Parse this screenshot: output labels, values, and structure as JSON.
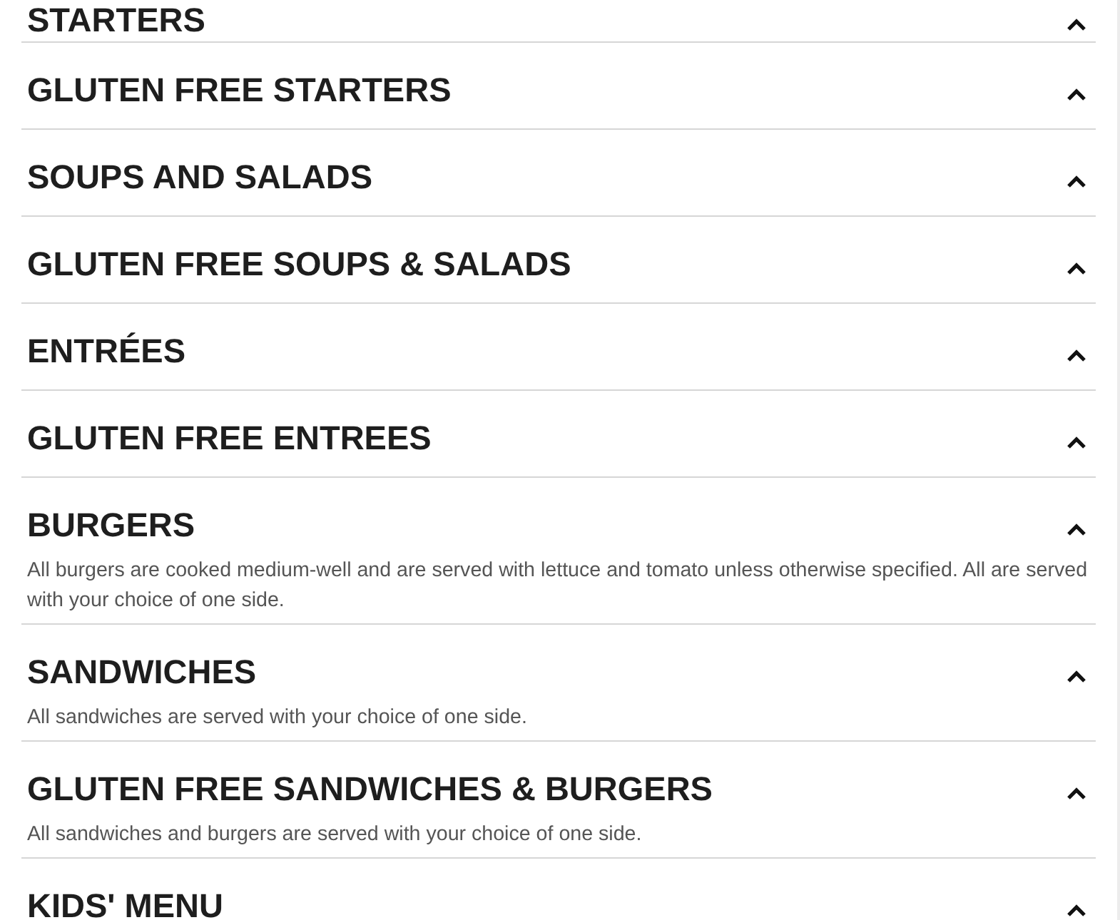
{
  "sections": [
    {
      "title": "STARTERS"
    },
    {
      "title": "GLUTEN FREE STARTERS"
    },
    {
      "title": "SOUPS AND SALADS"
    },
    {
      "title": "GLUTEN FREE SOUPS & SALADS"
    },
    {
      "title": "ENTRÉES"
    },
    {
      "title": "GLUTEN FREE ENTREES"
    },
    {
      "title": "BURGERS",
      "description": "All burgers are cooked medium-well and are served with lettuce and tomato unless otherwise specified. All are served with your choice of one side."
    },
    {
      "title": "SANDWICHES",
      "description": "All sandwiches are served with your choice of one side."
    },
    {
      "title": "GLUTEN FREE SANDWICHES & BURGERS",
      "description": "All sandwiches and burgers are served with your choice of one side."
    },
    {
      "title": "KIDS' MENU"
    }
  ]
}
